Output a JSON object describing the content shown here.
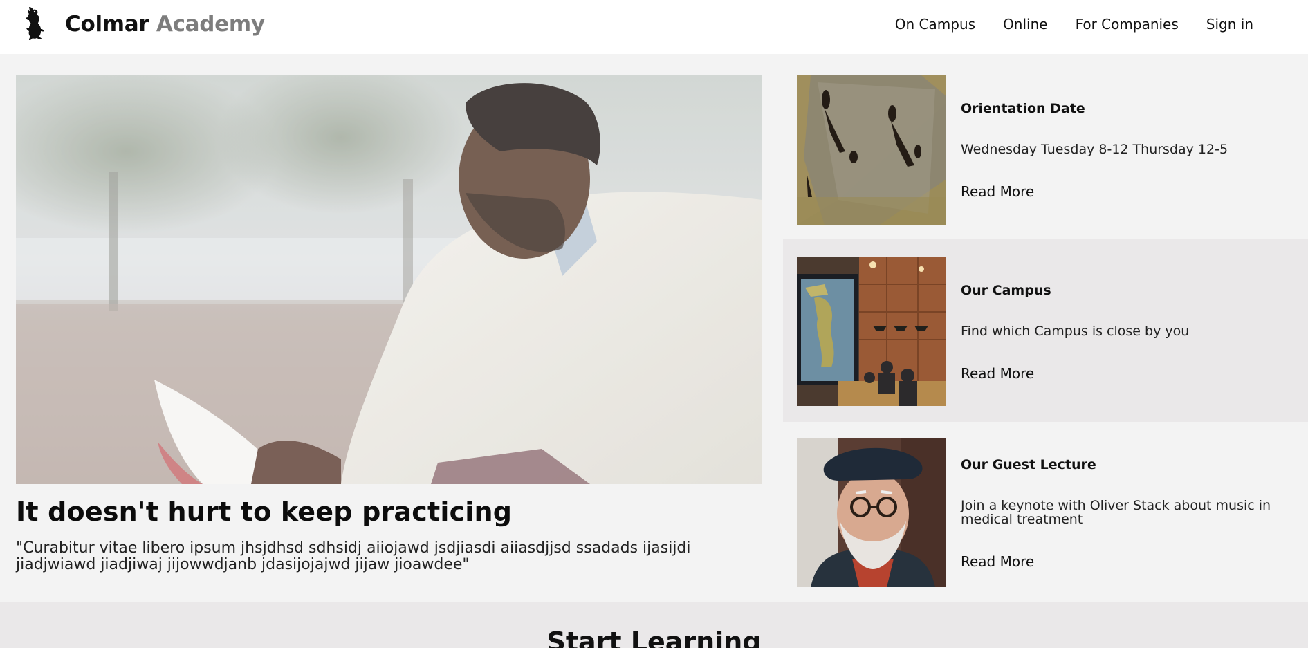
{
  "header": {
    "brand_primary": "Colmar",
    "brand_secondary": "Academy",
    "logo_icon": "lion-rampant-icon",
    "nav": [
      {
        "label": "On Campus"
      },
      {
        "label": "Online"
      },
      {
        "label": "For Companies"
      },
      {
        "label": "Sign in"
      }
    ]
  },
  "hero": {
    "image_icon": "student-reading-photo",
    "title": "It doesn't hurt to keep practicing",
    "quote": "\"Curabitur vitae libero ipsum jhsjdhsd sdhsidj aiiojawd jsdjiasdi aiiasdjjsd ssadads ijasijdi jiadjwiawd jiadjiwaj jijowwdjanb jdasijojajwd jijaw jioawdee\""
  },
  "cards": [
    {
      "title": "Orientation Date",
      "description": "Wednesday Tuesday 8-12 Thursday 12-5",
      "link": "Read More",
      "image_icon": "people-shadows-photo"
    },
    {
      "title": "Our Campus",
      "description": "Find which Campus is close by you",
      "link": "Read More",
      "image_icon": "campus-interior-photo"
    },
    {
      "title": "Our Guest Lecture",
      "description": "Join a keynote with Oliver Stack about music in medical treatment",
      "link": "Read More",
      "image_icon": "guest-lecturer-photo"
    }
  ],
  "section": {
    "title": "Start Learning"
  },
  "colors": {
    "page_bg": "#f3f3f3",
    "header_bg": "#ffffff",
    "alt_bg": "#eae8e9",
    "brand_grey": "#7d7d7d"
  }
}
